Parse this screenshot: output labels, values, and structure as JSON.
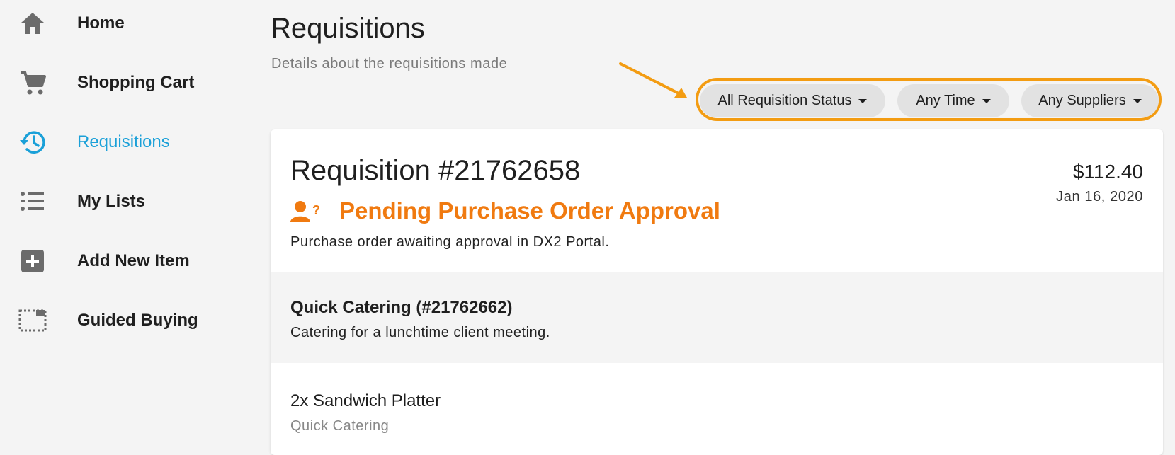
{
  "sidebar": {
    "items": [
      {
        "label": "Home",
        "icon": "home-icon"
      },
      {
        "label": "Shopping Cart",
        "icon": "cart-icon"
      },
      {
        "label": "Requisitions",
        "icon": "history-icon"
      },
      {
        "label": "My Lists",
        "icon": "list-icon"
      },
      {
        "label": "Add New Item",
        "icon": "add-box-icon"
      },
      {
        "label": "Guided Buying",
        "icon": "dashed-box-icon"
      }
    ],
    "active_color": "#1aa0d8"
  },
  "header": {
    "title": "Requisitions",
    "subtitle": "Details about the requisitions made"
  },
  "filters": [
    {
      "label": "All Requisition Status"
    },
    {
      "label": "Any Time"
    },
    {
      "label": "Any Suppliers"
    }
  ],
  "requisition": {
    "title": "Requisition #21762658",
    "amount": "$112.40",
    "date": "Jan 16, 2020",
    "status": "Pending Purchase Order Approval",
    "status_icon": "person-question-icon",
    "status_color": "#f07a10",
    "status_description": "Purchase order awaiting approval in DX2 Portal.",
    "supplier": {
      "name": "Quick Catering (#21762662)",
      "description": "Catering for a lunchtime client meeting."
    },
    "items": [
      {
        "name": "2x Sandwich Platter",
        "supplier": "Quick Catering"
      }
    ]
  },
  "annotation_color": "#f39c12"
}
